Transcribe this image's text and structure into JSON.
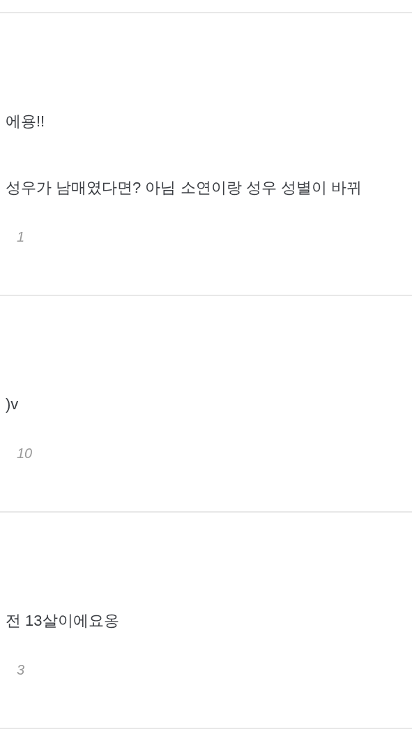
{
  "posts": [
    {
      "lines": [
        "에용!!",
        "성우가 남매였다면? 아님 소연이랑 성우 성별이 바뀌"
      ],
      "comment_count": "1"
    },
    {
      "lines": [
        ")v"
      ],
      "comment_count": "10"
    },
    {
      "lines": [
        "전 13살이에요옹"
      ],
      "comment_count": "3"
    }
  ]
}
